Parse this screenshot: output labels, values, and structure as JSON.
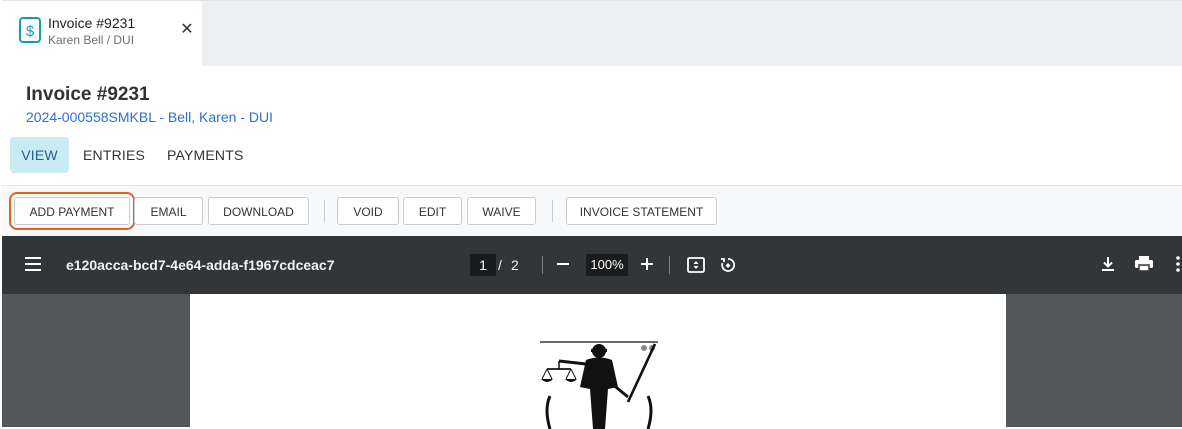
{
  "tab": {
    "title": "Invoice #9231",
    "subtitle": "Karen Bell / DUI",
    "close_icon": "close-icon",
    "icon": "dollar-document-icon"
  },
  "header": {
    "title": "Invoice #9231",
    "subtitle": "2024-000558SMKBL - Bell, Karen - DUI"
  },
  "nav_tabs": [
    {
      "label": "VIEW",
      "active": true
    },
    {
      "label": "ENTRIES",
      "active": false
    },
    {
      "label": "PAYMENTS",
      "active": false
    }
  ],
  "toolbar": {
    "add_payment": "ADD PAYMENT",
    "email": "EMAIL",
    "download": "DOWNLOAD",
    "void": "VOID",
    "edit": "EDIT",
    "waive": "WAIVE",
    "invoice_statement": "INVOICE STATEMENT"
  },
  "pdf_viewer": {
    "file_name": "e120acca-bcd7-4e64-adda-f1967cdceac7",
    "current_page": "1",
    "page_separator": "/",
    "total_pages": "2",
    "zoom": "100%",
    "icons": [
      "menu-icon",
      "zoom-out-icon",
      "zoom-in-icon",
      "fit-page-icon",
      "rotate-icon",
      "download-icon",
      "print-icon",
      "more-icon"
    ]
  },
  "colors": {
    "accent": "#c9ecf4",
    "link": "#2f6fcf",
    "highlight": "#e0621b",
    "pdf_toolbar": "#323639"
  }
}
